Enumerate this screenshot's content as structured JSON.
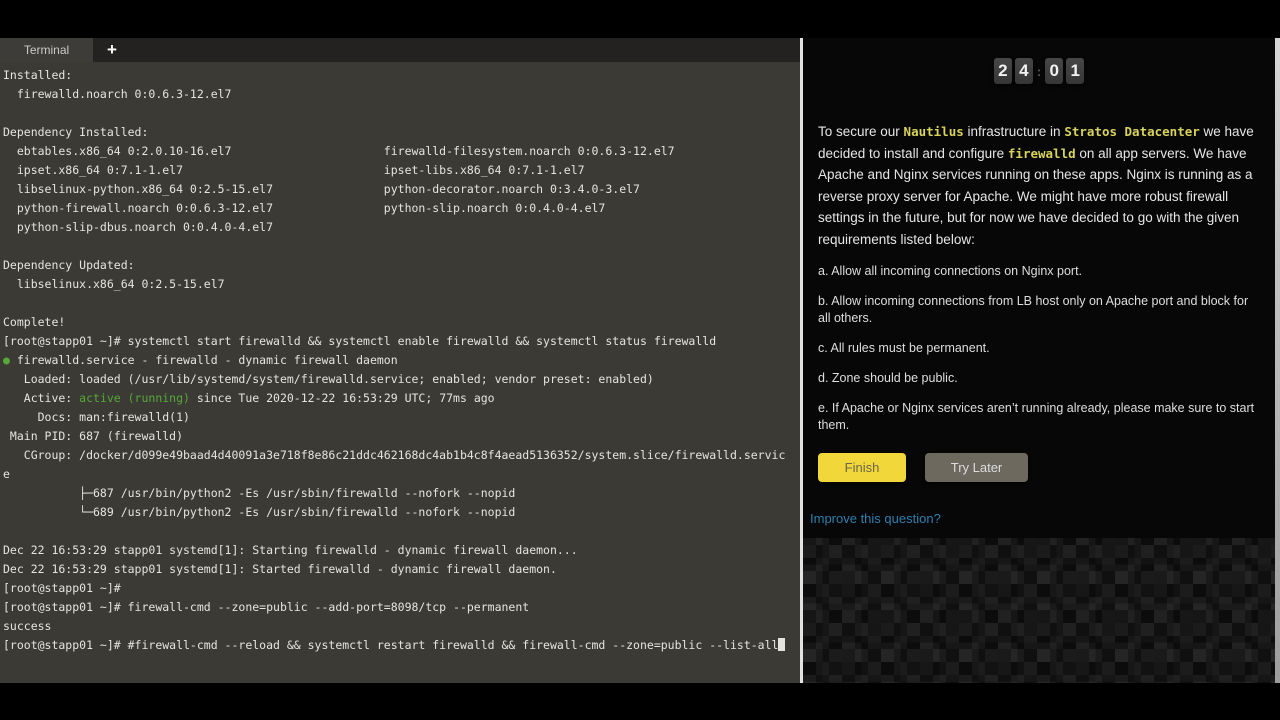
{
  "terminal": {
    "tab_label": "Terminal",
    "new_tab_label": "+",
    "lines": [
      [
        [
          "Installed:"
        ]
      ],
      [
        [
          "  firewalld.noarch 0:0.6.3-12.el7"
        ]
      ],
      [
        [
          ""
        ]
      ],
      [
        [
          "Dependency Installed:"
        ]
      ],
      [
        [
          "  ebtables.x86_64 0:2.0.10-16.el7                      firewalld-filesystem.noarch 0:0.6.3-12.el7"
        ]
      ],
      [
        [
          "  ipset.x86_64 0:7.1-1.el7                             ipset-libs.x86_64 0:7.1-1.el7"
        ]
      ],
      [
        [
          "  libselinux-python.x86_64 0:2.5-15.el7                python-decorator.noarch 0:3.4.0-3.el7"
        ]
      ],
      [
        [
          "  python-firewall.noarch 0:0.6.3-12.el7                python-slip.noarch 0:0.4.0-4.el7"
        ]
      ],
      [
        [
          "  python-slip-dbus.noarch 0:0.4.0-4.el7"
        ]
      ],
      [
        [
          ""
        ]
      ],
      [
        [
          "Dependency Updated:"
        ]
      ],
      [
        [
          "  libselinux.x86_64 0:2.5-15.el7"
        ]
      ],
      [
        [
          ""
        ]
      ],
      [
        [
          "Complete!"
        ]
      ],
      [
        [
          "[root@stapp01 ~]# systemctl start firewalld && systemctl enable firewalld && systemctl status firewalld"
        ]
      ],
      [
        [
          "● ",
          "green"
        ],
        [
          "firewalld.service - firewalld - dynamic firewall daemon"
        ]
      ],
      [
        [
          "   Loaded: loaded (/usr/lib/systemd/system/firewalld.service; enabled; vendor preset: enabled)"
        ]
      ],
      [
        [
          "   Active: "
        ],
        [
          "active (running)",
          "green"
        ],
        [
          " since Tue 2020-12-22 16:53:29 UTC; 77ms ago"
        ]
      ],
      [
        [
          "     Docs: man:firewalld(1)"
        ]
      ],
      [
        [
          " Main PID: 687 (firewalld)"
        ]
      ],
      [
        [
          "   CGroup: /docker/d099e49baad4d40091a3e718f8e86c21ddc462168dc4ab1b4c8f4aead5136352/system.slice/firewalld.servic"
        ]
      ],
      [
        [
          "e"
        ]
      ],
      [
        [
          "           ├─687 /usr/bin/python2 -Es /usr/sbin/firewalld --nofork --nopid"
        ]
      ],
      [
        [
          "           └─689 /usr/bin/python2 -Es /usr/sbin/firewalld --nofork --nopid"
        ]
      ],
      [
        [
          ""
        ]
      ],
      [
        [
          "Dec 22 16:53:29 stapp01 systemd[1]: Starting firewalld - dynamic firewall daemon..."
        ]
      ],
      [
        [
          "Dec 22 16:53:29 stapp01 systemd[1]: Started firewalld - dynamic firewall daemon."
        ]
      ],
      [
        [
          "[root@stapp01 ~]#"
        ]
      ],
      [
        [
          "[root@stapp01 ~]# firewall-cmd --zone=public --add-port=8098/tcp --permanent"
        ]
      ],
      [
        [
          "success"
        ]
      ],
      [
        [
          "[root@stapp01 ~]# #firewall-cmd --reload && systemctl restart firewalld && firewall-cmd --zone=public --list-all"
        ],
        [
          "",
          "cursor"
        ]
      ]
    ]
  },
  "panel": {
    "timer": {
      "digits": [
        "2",
        "4",
        "0",
        "1"
      ],
      "separator": ":"
    },
    "question_segments": [
      [
        "To secure our "
      ],
      [
        "Nautilus",
        "code"
      ],
      [
        " infrastructure in "
      ],
      [
        "Stratos Datacenter",
        "code"
      ],
      [
        " we have decided to install and configure "
      ],
      [
        "firewalld",
        "code"
      ],
      [
        " on all app servers. We have Apache and Nginx services running on these apps. Nginx is running as a reverse proxy server for Apache. We might have more robust firewall settings in the future, but for now we have decided to go with the given requirements listed below:"
      ]
    ],
    "requirements": [
      "a. Allow all incoming connections on Nginx port.",
      "b. Allow incoming connections from LB host only on Apache port and block for all others.",
      "c. All rules must be permanent.",
      "d. Zone should be public.",
      "e. If Apache or Nginx services aren’t running already, please make sure to start them."
    ],
    "finish_label": "Finish",
    "try_later_label": "Try Later",
    "improve_link": "Improve this question?",
    "colors": {
      "finish_yellow": "#f2d73a",
      "try_later_gray": "#6e695e",
      "code_yellow": "#d8d35a",
      "link_blue": "#2e7fb0",
      "terminal_green": "#55a839",
      "terminal_background": "#3b3a35"
    }
  }
}
